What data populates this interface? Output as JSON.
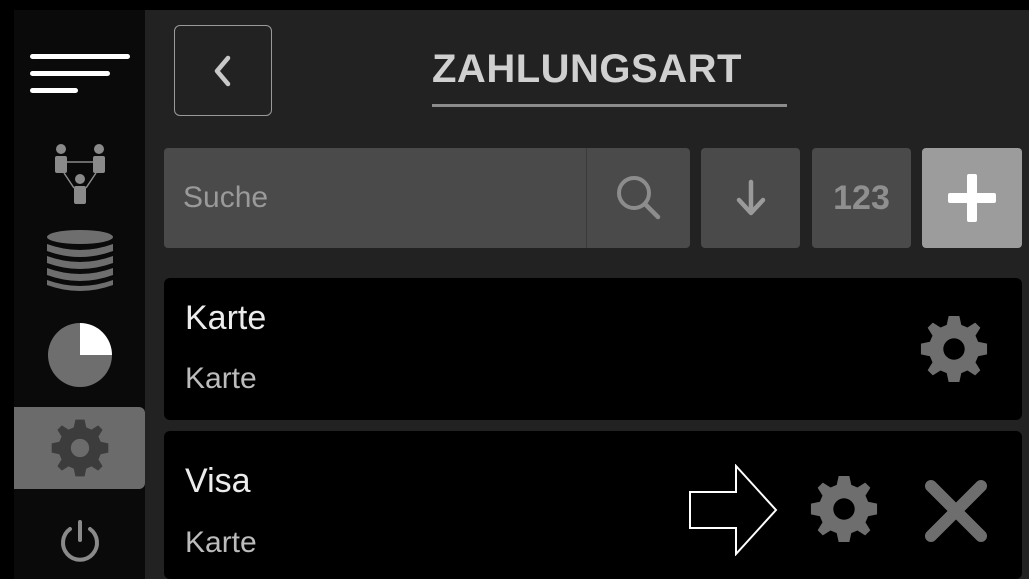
{
  "header": {
    "title": "ZAHLUNGSART",
    "back_icon": "chevron-left-icon"
  },
  "sidebar": {
    "items": [
      {
        "name": "menu",
        "icon": "hamburger-menu-icon",
        "active": false
      },
      {
        "name": "users",
        "icon": "user-hierarchy-icon",
        "active": false
      },
      {
        "name": "database",
        "icon": "database-stack-icon",
        "active": false
      },
      {
        "name": "reports",
        "icon": "pie-chart-icon",
        "active": false
      },
      {
        "name": "settings",
        "icon": "gear-icon",
        "active": true
      },
      {
        "name": "power",
        "icon": "power-icon",
        "active": false
      }
    ]
  },
  "toolbar": {
    "search_placeholder": "Suche",
    "search_icon": "search-icon",
    "sort_icon": "arrow-down-icon",
    "numeric_label": "123",
    "add_icon": "plus-icon"
  },
  "payment_methods": [
    {
      "name": "Karte",
      "type": "Karte",
      "settings_icon": "gear-icon"
    },
    {
      "name": "Visa",
      "type": "Karte",
      "settings_icon": "gear-icon",
      "delete_icon": "close-icon",
      "pointer_icon": "arrow-right-outline-icon"
    }
  ],
  "colors": {
    "background": "#222222",
    "sidebar": "#0a0a0a",
    "sidebar_active": "#6b6b6b",
    "button": "#4a4a4a",
    "add_button": "#9c9c9c",
    "list_item": "#000000",
    "icon": "#6e6e6e"
  }
}
